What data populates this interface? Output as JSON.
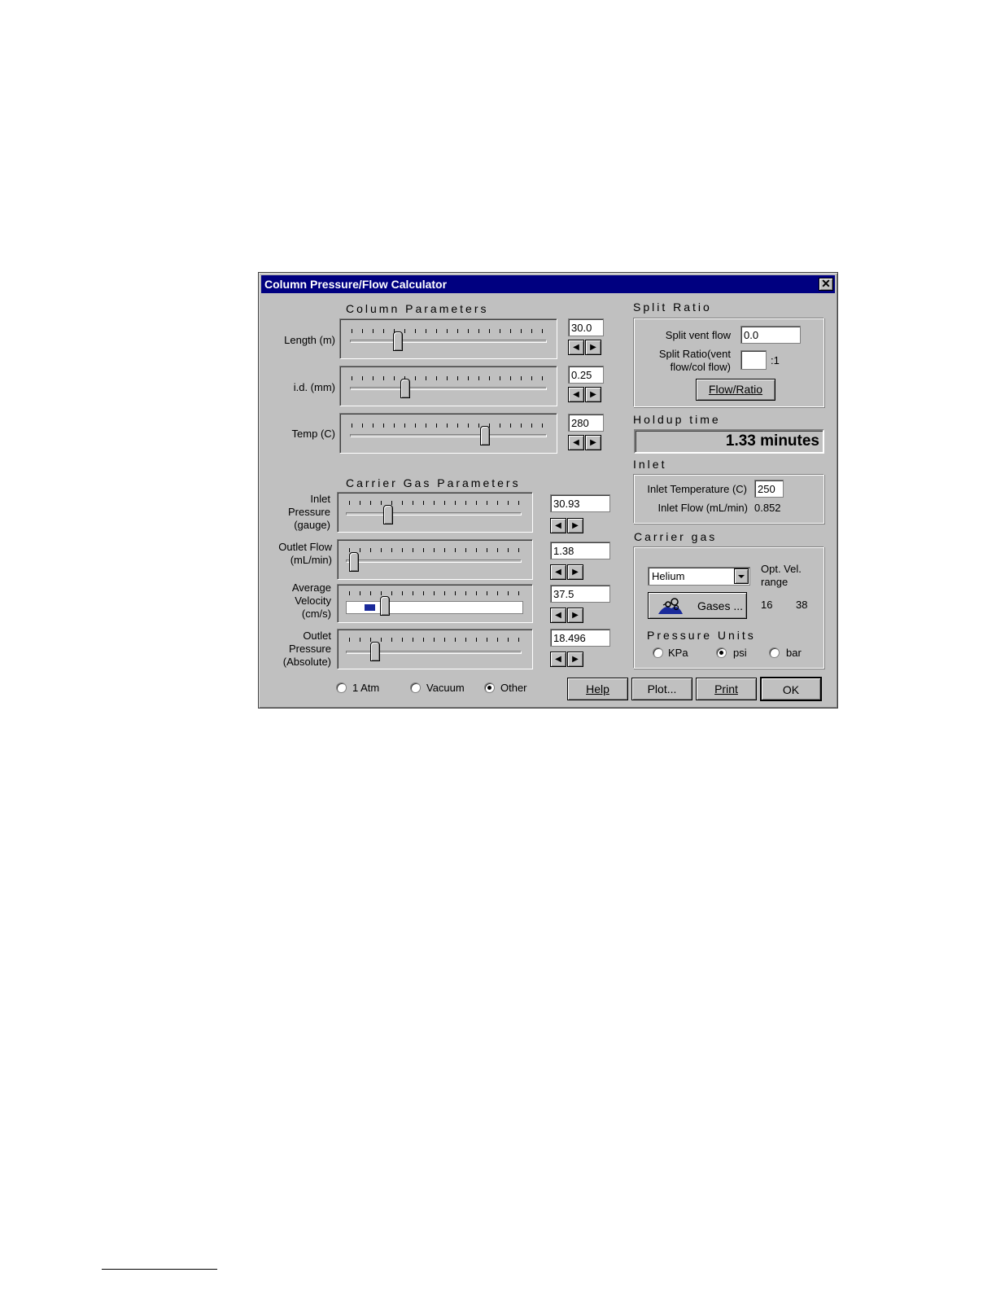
{
  "window": {
    "title": "Column Pressure/Flow Calculator",
    "close_glyph": "✕"
  },
  "column_params": {
    "title": "Column Parameters",
    "length": {
      "label": "Length (m)",
      "value": "30.0"
    },
    "id": {
      "label": "i.d. (mm)",
      "value": "0.25"
    },
    "temp": {
      "label": "Temp (C)",
      "value": "280"
    }
  },
  "carrier_params": {
    "title": "Carrier Gas Parameters",
    "inlet_pressure": {
      "label_lines": [
        "Inlet",
        "Pressure",
        "(gauge)"
      ],
      "value": "30.93"
    },
    "outlet_flow": {
      "label_lines": [
        "Outlet Flow",
        "(mL/min)"
      ],
      "value": "1.38"
    },
    "avg_velocity": {
      "label_lines": [
        "Average",
        "Velocity",
        "(cm/s)"
      ],
      "value": "37.5"
    },
    "outlet_pressure": {
      "label_lines": [
        "Outlet",
        "Pressure",
        "(Absolute)"
      ],
      "value": "18.496"
    }
  },
  "outlet_mode": {
    "options": [
      "1 Atm",
      "Vacuum",
      "Other"
    ],
    "selected": "Other"
  },
  "split": {
    "title": "Split Ratio",
    "vent_flow_label": "Split vent flow",
    "vent_flow_value": "0.0",
    "ratio_label_lines": [
      "Split Ratio(vent",
      "flow/col flow)"
    ],
    "ratio_value": "",
    "ratio_suffix": ":1",
    "button_label": "Flow/Ratio"
  },
  "holdup": {
    "title": "Holdup time",
    "value": "1.33 minutes"
  },
  "inlet": {
    "title": "Inlet",
    "temp_label": "Inlet Temperature (C)",
    "temp_value": "250",
    "flow_label": "Inlet Flow (mL/min)",
    "flow_value": "0.852"
  },
  "carrier_gas": {
    "title": "Carrier gas",
    "selected_gas": "Helium",
    "gases_button": "Gases ...",
    "opt_vel_label_lines": [
      "Opt. Vel.",
      "range"
    ],
    "opt_vel_low": "16",
    "opt_vel_high": "38",
    "pressure_units_title": "Pressure Units",
    "units": [
      "KPa",
      "psi",
      "bar"
    ],
    "selected_unit": "psi"
  },
  "buttons": {
    "help": "Help",
    "plot": "Plot...",
    "print": "Print",
    "ok": "OK"
  },
  "slider_levels": {
    "length": 0.23,
    "id": 0.27,
    "temp": 0.68,
    "inlet_pressure": 0.22,
    "outlet_flow": 0.02,
    "avg_velocity": 0.2,
    "outlet_pressure": 0.14
  },
  "colors": {
    "titlebar": "#000080",
    "face": "#c0c0c0",
    "velocity_marker": "#1a2a9a"
  }
}
